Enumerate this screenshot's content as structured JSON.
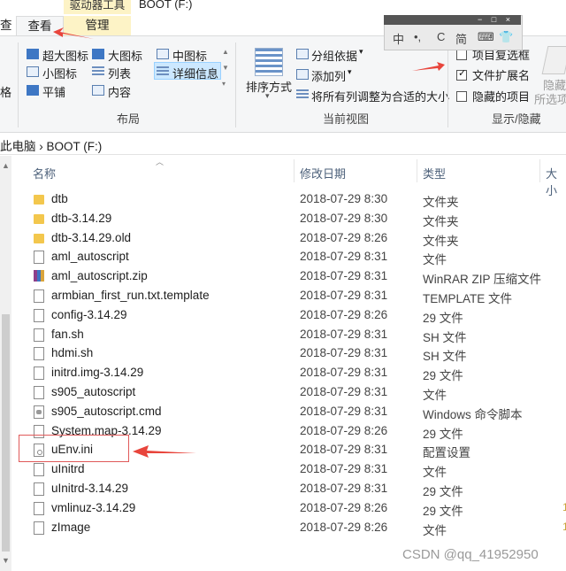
{
  "window": {
    "title": "BOOT (F:)",
    "context_tab": "驱动器工具"
  },
  "tabs": [
    {
      "label": "查看"
    },
    {
      "label": "管理"
    }
  ],
  "tab_left_partial": "查",
  "ribbon": {
    "layout": {
      "items": [
        "超大图标",
        "大图标",
        "中图标",
        "小图标",
        "列表",
        "详细信息",
        "平铺",
        "内容"
      ],
      "label": "布局",
      "pane_partial": "格"
    },
    "current_view": {
      "sort_label": "排序方式",
      "group_by": "分组依据",
      "add_column": "添加列",
      "fit_columns": "将所有列调整为合适的大小",
      "label": "当前视图"
    },
    "show_hide": {
      "item_checkboxes": "项目复选框",
      "file_extensions": "文件扩展名",
      "hidden_items": "隐藏的项目",
      "hide_selected": "隐藏",
      "hide_selected_sub": "所选项",
      "label": "显示/隐藏",
      "checked": {
        "item_checkboxes": false,
        "file_extensions": true,
        "hidden_items": false
      }
    }
  },
  "ime": {
    "items": [
      "中",
      "•,",
      "C",
      "简",
      "⌨",
      "👕"
    ]
  },
  "breadcrumb": {
    "path": "此电脑 › BOOT (F:)"
  },
  "columns": {
    "name": "名称",
    "date": "修改日期",
    "type": "类型",
    "size": "大小"
  },
  "files": [
    {
      "name": "dtb",
      "date": "2018-07-29 8:30",
      "type": "文件夹",
      "icon": "folder-icon"
    },
    {
      "name": "dtb-3.14.29",
      "date": "2018-07-29 8:30",
      "type": "文件夹",
      "icon": "folder-icon"
    },
    {
      "name": "dtb-3.14.29.old",
      "date": "2018-07-29 8:26",
      "type": "文件夹",
      "icon": "folder-icon"
    },
    {
      "name": "aml_autoscript",
      "date": "2018-07-29 8:31",
      "type": "文件",
      "icon": "file-icon"
    },
    {
      "name": "aml_autoscript.zip",
      "date": "2018-07-29 8:31",
      "type": "WinRAR ZIP 压缩文件",
      "icon": "winrar-icon"
    },
    {
      "name": "armbian_first_run.txt.template",
      "date": "2018-07-29 8:31",
      "type": "TEMPLATE 文件",
      "icon": "file-icon"
    },
    {
      "name": "config-3.14.29",
      "date": "2018-07-29 8:26",
      "type": "29 文件",
      "icon": "file-icon"
    },
    {
      "name": "fan.sh",
      "date": "2018-07-29 8:31",
      "type": "SH 文件",
      "icon": "file-icon"
    },
    {
      "name": "hdmi.sh",
      "date": "2018-07-29 8:31",
      "type": "SH 文件",
      "icon": "file-icon"
    },
    {
      "name": "initrd.img-3.14.29",
      "date": "2018-07-29 8:31",
      "type": "29 文件",
      "icon": "file-icon"
    },
    {
      "name": "s905_autoscript",
      "date": "2018-07-29 8:31",
      "type": "文件",
      "icon": "file-icon"
    },
    {
      "name": "s905_autoscript.cmd",
      "date": "2018-07-29 8:31",
      "type": "Windows 命令脚本",
      "icon": "script-icon"
    },
    {
      "name": "System.map-3.14.29",
      "date": "2018-07-29 8:26",
      "type": "29 文件",
      "icon": "file-icon"
    },
    {
      "name": "uEnv.ini",
      "date": "2018-07-29 8:31",
      "type": "配置设置",
      "icon": "ini-icon"
    },
    {
      "name": "uInitrd",
      "date": "2018-07-29 8:31",
      "type": "文件",
      "icon": "file-icon"
    },
    {
      "name": "uInitrd-3.14.29",
      "date": "2018-07-29 8:31",
      "type": "29 文件",
      "icon": "file-icon"
    },
    {
      "name": "vmlinuz-3.14.29",
      "date": "2018-07-29 8:26",
      "type": "29 文件",
      "icon": "file-icon",
      "size_partial": "1"
    },
    {
      "name": "zImage",
      "date": "2018-07-29 8:26",
      "type": "文件",
      "icon": "file-icon",
      "size_partial": "1"
    }
  ],
  "watermark": "CSDN @qq_41952950",
  "colors": {
    "accent": "#cce8ff",
    "context_tab": "#fdf3c6",
    "annotation": "#e05a5a",
    "folder": "#f3c74d"
  }
}
